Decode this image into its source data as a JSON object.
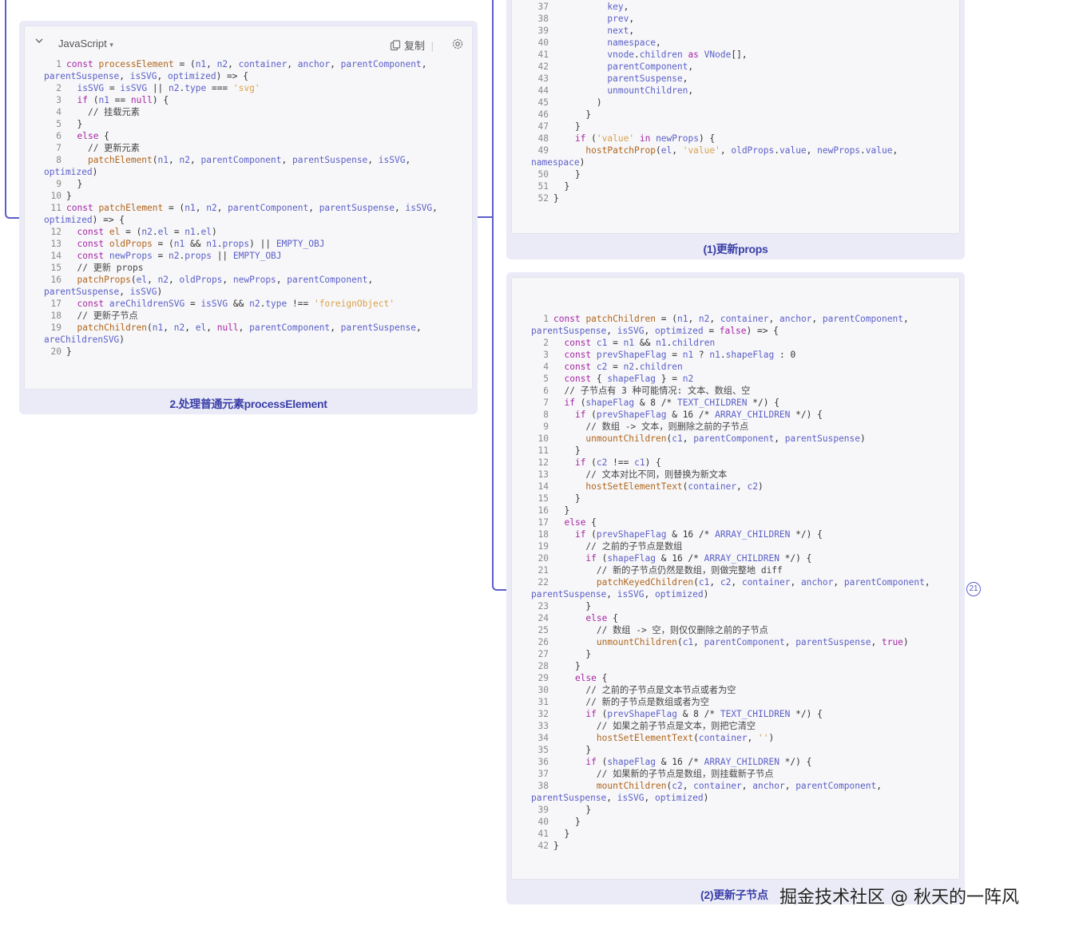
{
  "left_card": {
    "language": "JavaScript",
    "copy_label": "复制",
    "caption": "2.处理普通元素processElement",
    "lines": [
      {
        "n": "1",
        "t": "const processElement = (n1, n2, container, anchor, parentComponent,"
      },
      {
        "n": "",
        "t": "parentSuspense, isSVG, optimized) => {"
      },
      {
        "n": "2",
        "t": "  isSVG = isSVG || n2.type === 'svg'"
      },
      {
        "n": "3",
        "t": "  if (n1 == null) {"
      },
      {
        "n": "4",
        "t": "    // 挂载元素"
      },
      {
        "n": "5",
        "t": "  }"
      },
      {
        "n": "6",
        "t": "  else {"
      },
      {
        "n": "7",
        "t": "    // 更新元素"
      },
      {
        "n": "8",
        "t": "    patchElement(n1, n2, parentComponent, parentSuspense, isSVG,"
      },
      {
        "n": "",
        "t": "optimized)"
      },
      {
        "n": "9",
        "t": "  }"
      },
      {
        "n": "10",
        "t": "}"
      },
      {
        "n": "11",
        "t": "const patchElement = (n1, n2, parentComponent, parentSuspense, isSVG,"
      },
      {
        "n": "",
        "t": "optimized) => {"
      },
      {
        "n": "12",
        "t": "  const el = (n2.el = n1.el)"
      },
      {
        "n": "13",
        "t": "  const oldProps = (n1 && n1.props) || EMPTY_OBJ"
      },
      {
        "n": "14",
        "t": "  const newProps = n2.props || EMPTY_OBJ"
      },
      {
        "n": "15",
        "t": "  // 更新 props"
      },
      {
        "n": "16",
        "t": "  patchProps(el, n2, oldProps, newProps, parentComponent,"
      },
      {
        "n": "",
        "t": "parentSuspense, isSVG)"
      },
      {
        "n": "17",
        "t": "  const areChildrenSVG = isSVG && n2.type !== 'foreignObject'"
      },
      {
        "n": "18",
        "t": "  // 更新子节点"
      },
      {
        "n": "19",
        "t": "  patchChildren(n1, n2, el, null, parentComponent, parentSuspense,"
      },
      {
        "n": "",
        "t": "areChildrenSVG)"
      },
      {
        "n": "20",
        "t": "}"
      }
    ]
  },
  "top_right_card": {
    "caption": "(1)更新props",
    "lines": [
      {
        "n": "37",
        "t": "          key,"
      },
      {
        "n": "38",
        "t": "          prev,"
      },
      {
        "n": "39",
        "t": "          next,"
      },
      {
        "n": "40",
        "t": "          namespace,"
      },
      {
        "n": "41",
        "t": "          vnode.children as VNode[],"
      },
      {
        "n": "42",
        "t": "          parentComponent,"
      },
      {
        "n": "43",
        "t": "          parentSuspense,"
      },
      {
        "n": "44",
        "t": "          unmountChildren,"
      },
      {
        "n": "45",
        "t": "        )"
      },
      {
        "n": "46",
        "t": "      }"
      },
      {
        "n": "47",
        "t": "    }"
      },
      {
        "n": "48",
        "t": "    if ('value' in newProps) {"
      },
      {
        "n": "49",
        "t": "      hostPatchProp(el, 'value', oldProps.value, newProps.value,"
      },
      {
        "n": "",
        "t": "namespace)"
      },
      {
        "n": "50",
        "t": "    }"
      },
      {
        "n": "51",
        "t": "  }"
      },
      {
        "n": "52",
        "t": "}"
      }
    ]
  },
  "bottom_right_card": {
    "caption": "(2)更新子节点",
    "lines": [
      {
        "n": "1",
        "t": "const patchChildren = (n1, n2, container, anchor, parentComponent,"
      },
      {
        "n": "",
        "t": "parentSuspense, isSVG, optimized = false) => {"
      },
      {
        "n": "2",
        "t": "  const c1 = n1 && n1.children"
      },
      {
        "n": "3",
        "t": "  const prevShapeFlag = n1 ? n1.shapeFlag : 0"
      },
      {
        "n": "4",
        "t": "  const c2 = n2.children"
      },
      {
        "n": "5",
        "t": "  const { shapeFlag } = n2"
      },
      {
        "n": "6",
        "t": "  // 子节点有 3 种可能情况: 文本、数组、空"
      },
      {
        "n": "7",
        "t": "  if (shapeFlag & 8 /* TEXT_CHILDREN */) {"
      },
      {
        "n": "8",
        "t": "    if (prevShapeFlag & 16 /* ARRAY_CHILDREN */) {"
      },
      {
        "n": "9",
        "t": "      // 数组 -> 文本，则删除之前的子节点"
      },
      {
        "n": "10",
        "t": "      unmountChildren(c1, parentComponent, parentSuspense)"
      },
      {
        "n": "11",
        "t": "    }"
      },
      {
        "n": "12",
        "t": "    if (c2 !== c1) {"
      },
      {
        "n": "13",
        "t": "      // 文本对比不同，则替换为新文本"
      },
      {
        "n": "14",
        "t": "      hostSetElementText(container, c2)"
      },
      {
        "n": "15",
        "t": "    }"
      },
      {
        "n": "16",
        "t": "  }"
      },
      {
        "n": "17",
        "t": "  else {"
      },
      {
        "n": "18",
        "t": "    if (prevShapeFlag & 16 /* ARRAY_CHILDREN */) {"
      },
      {
        "n": "19",
        "t": "      // 之前的子节点是数组"
      },
      {
        "n": "20",
        "t": "      if (shapeFlag & 16 /* ARRAY_CHILDREN */) {"
      },
      {
        "n": "21",
        "t": "        // 新的子节点仍然是数组，则做完整地 diff"
      },
      {
        "n": "22",
        "t": "        patchKeyedChildren(c1, c2, container, anchor, parentComponent,"
      },
      {
        "n": "",
        "t": "parentSuspense, isSVG, optimized)"
      },
      {
        "n": "23",
        "t": "      }"
      },
      {
        "n": "24",
        "t": "      else {"
      },
      {
        "n": "25",
        "t": "        // 数组 -> 空，则仅仅删除之前的子节点"
      },
      {
        "n": "26",
        "t": "        unmountChildren(c1, parentComponent, parentSuspense, true)"
      },
      {
        "n": "27",
        "t": "      }"
      },
      {
        "n": "28",
        "t": "    }"
      },
      {
        "n": "29",
        "t": "    else {"
      },
      {
        "n": "30",
        "t": "      // 之前的子节点是文本节点或者为空"
      },
      {
        "n": "31",
        "t": "      // 新的子节点是数组或者为空"
      },
      {
        "n": "32",
        "t": "      if (prevShapeFlag & 8 /* TEXT_CHILDREN */) {"
      },
      {
        "n": "33",
        "t": "        // 如果之前子节点是文本，则把它清空"
      },
      {
        "n": "34",
        "t": "        hostSetElementText(container, '')"
      },
      {
        "n": "35",
        "t": "      }"
      },
      {
        "n": "36",
        "t": "      if (shapeFlag & 16 /* ARRAY_CHILDREN */) {"
      },
      {
        "n": "37",
        "t": "        // 如果新的子节点是数组，则挂载新子节点"
      },
      {
        "n": "38",
        "t": "        mountChildren(c2, container, anchor, parentComponent,"
      },
      {
        "n": "",
        "t": "parentSuspense, isSVG, optimized)"
      },
      {
        "n": "39",
        "t": "      }"
      },
      {
        "n": "40",
        "t": "    }"
      },
      {
        "n": "41",
        "t": "  }"
      },
      {
        "n": "42",
        "t": "}"
      }
    ]
  },
  "badge": "21",
  "watermark": "掘金技术社区 @ 秋天的一阵风"
}
